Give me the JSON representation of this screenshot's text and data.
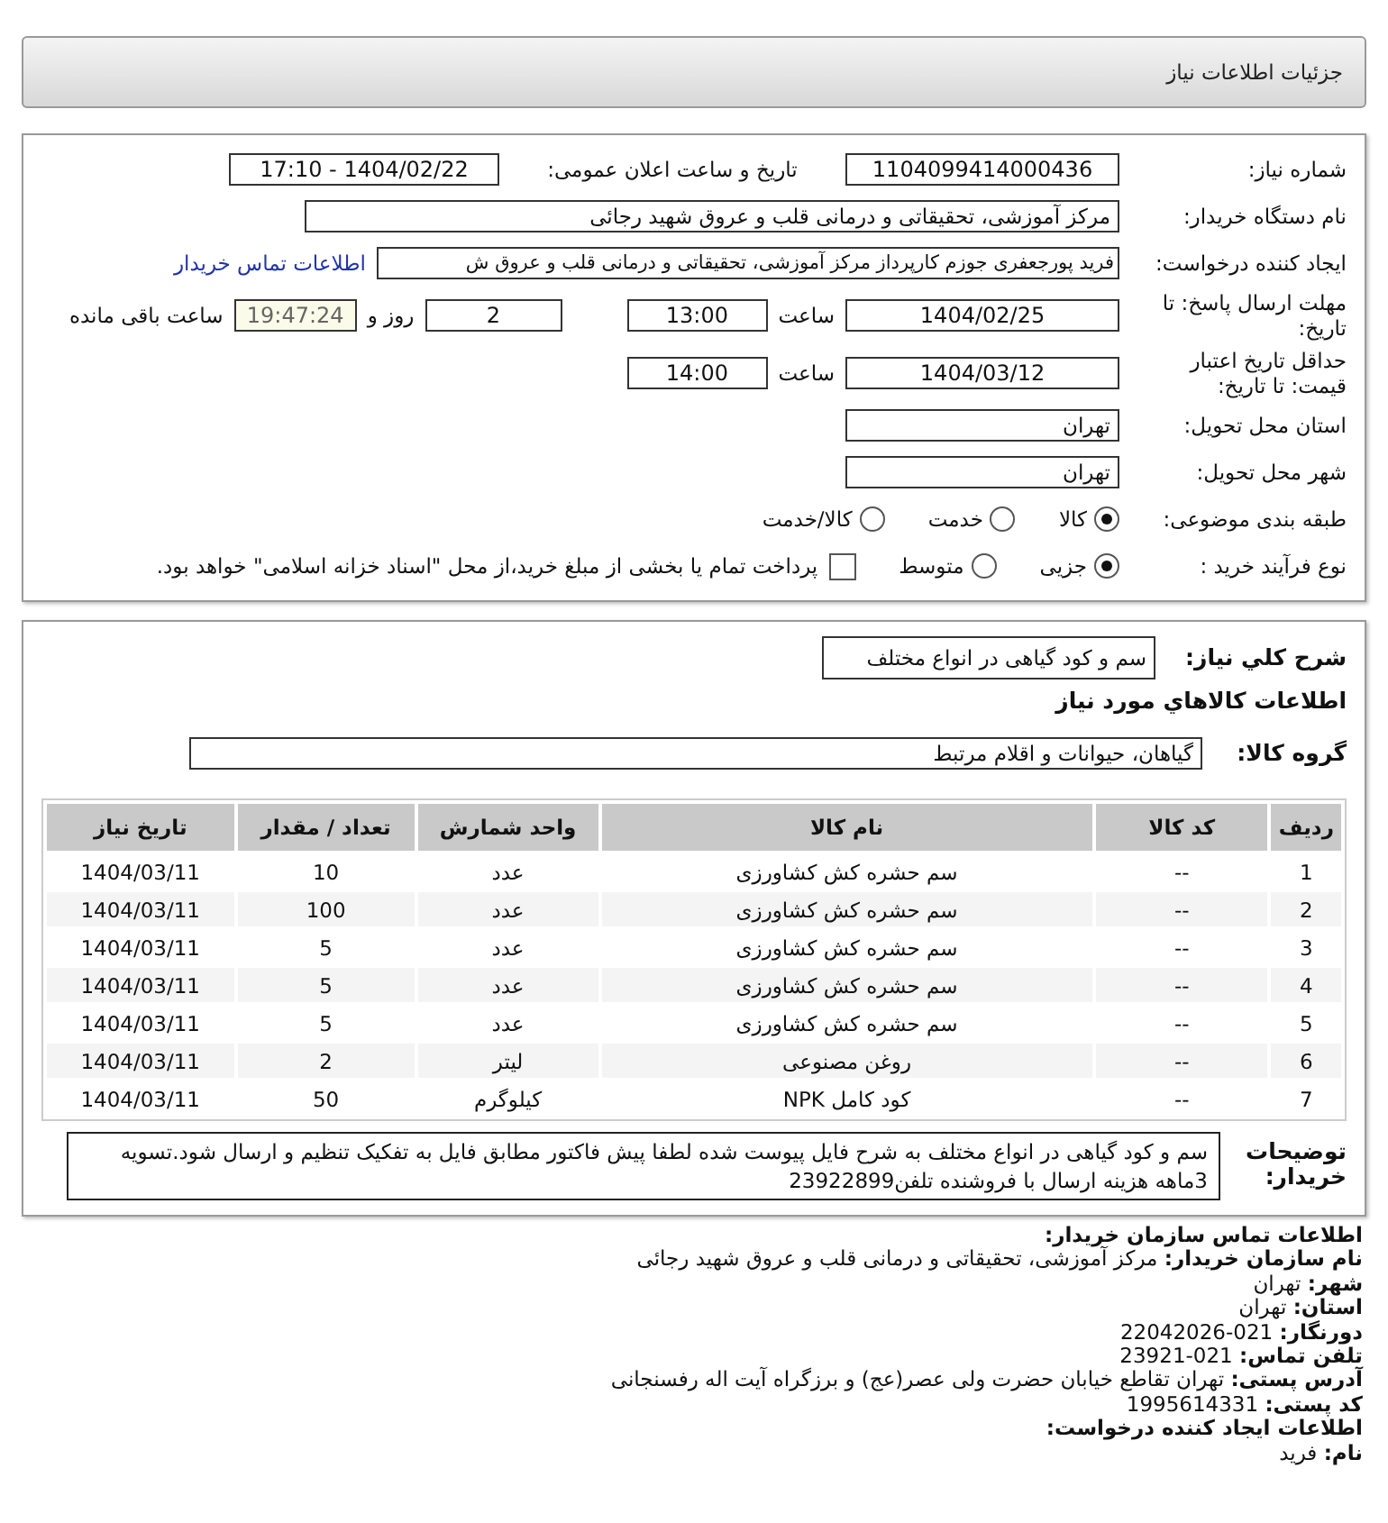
{
  "header": {
    "title": "جزئیات اطلاعات نیاز"
  },
  "need_number": {
    "label": "شماره نیاز:",
    "value": "1104099414000436"
  },
  "announce": {
    "label": "تاریخ و ساعت اعلان عمومی:",
    "value": "1404/02/22 - 17:10"
  },
  "buyer_org": {
    "label": "نام دستگاه خریدار:",
    "value": "مرکز آموزشی، تحقیقاتی و درمانی قلب و عروق شهید رجائی"
  },
  "creator": {
    "label": "ایجاد کننده درخواست:",
    "value": "فرید پورجعفری جوزم کارپرداز  مرکز آموزشی، تحقیقاتی و درمانی قلب و عروق ش",
    "link": "اطلاعات تماس خریدار"
  },
  "response_deadline": {
    "label": "مهلت ارسال پاسخ: تا تاریخ:",
    "date": "1404/02/25",
    "time_label": "ساعت",
    "time": "13:00",
    "days": "2",
    "days_label": "روز و",
    "remaining": "19:47:24",
    "remaining_label": "ساعت باقی مانده"
  },
  "price_validity": {
    "label": "حداقل تاریخ اعتبار قیمت: تا تاریخ:",
    "date": "1404/03/12",
    "time_label": "ساعت",
    "time": "14:00"
  },
  "province": {
    "label": "استان محل تحویل:",
    "value": "تهران"
  },
  "city": {
    "label": "شهر محل تحویل:",
    "value": "تهران"
  },
  "category": {
    "label": "طبقه بندی موضوعی:",
    "options": [
      {
        "label": "کالا",
        "selected": true
      },
      {
        "label": "خدمت",
        "selected": false
      },
      {
        "label": "کالا/خدمت",
        "selected": false
      }
    ]
  },
  "purchase_type": {
    "label": "نوع فرآیند خرید :",
    "options": [
      {
        "label": "جزیی",
        "selected": true
      },
      {
        "label": "متوسط",
        "selected": false
      }
    ],
    "payment": {
      "checked": false,
      "text": "پرداخت تمام یا بخشی از مبلغ خرید،از محل \"اسناد خزانه اسلامی\" خواهد بود."
    }
  },
  "summary": {
    "label": "شرح کلي نياز:",
    "value": "سم و کود گیاهی در انواع مختلف"
  },
  "goods_title": "اطلاعات کالاهاي مورد نياز",
  "goods_group": {
    "label": "گروه کالا:",
    "value": "گیاهان، حیوانات و اقلام مرتبط"
  },
  "table": {
    "columns": [
      "ردیف",
      "کد کالا",
      "نام کالا",
      "واحد شمارش",
      "تعداد / مقدار",
      "تاریخ نیاز"
    ],
    "rows": [
      [
        "1",
        "--",
        "سم حشره کش کشاورزی",
        "عدد",
        "10",
        "1404/03/11"
      ],
      [
        "2",
        "--",
        "سم حشره کش کشاورزی",
        "عدد",
        "100",
        "1404/03/11"
      ],
      [
        "3",
        "--",
        "سم حشره کش کشاورزی",
        "عدد",
        "5",
        "1404/03/11"
      ],
      [
        "4",
        "--",
        "سم حشره کش کشاورزی",
        "عدد",
        "5",
        "1404/03/11"
      ],
      [
        "5",
        "--",
        "سم حشره کش کشاورزی",
        "عدد",
        "5",
        "1404/03/11"
      ],
      [
        "6",
        "--",
        "روغن مصنوعی",
        "لیتر",
        "2",
        "1404/03/11"
      ],
      [
        "7",
        "--",
        "کود کامل NPK",
        "کیلوگرم",
        "50",
        "1404/03/11"
      ]
    ]
  },
  "buyer_notes": {
    "label": "توضیحات خریدار:",
    "value": "سم و کود گیاهی در انواع مختلف به شرح فایل پیوست شده لطفا پیش فاکتور مطابق فایل به تفکیک تنظیم و ارسال شود.تسویه 3ماهه هزینه ارسال با فروشنده تلفن23922899"
  },
  "buyer_contact": {
    "title": "اطلاعات تماس سازمان خریدار:",
    "lines": [
      {
        "label": "نام سازمان خریدار:",
        "value": "مرکز آموزشی، تحقیقاتی و درمانی قلب و عروق شهید رجائی"
      },
      {
        "label": "شهر:",
        "value": "تهران"
      },
      {
        "label": "استان:",
        "value": "تهران"
      },
      {
        "label": "دورنگار:",
        "value": "021-22042026"
      },
      {
        "label": "تلفن تماس:",
        "value": "021-23921"
      },
      {
        "label": "آدرس پستی:",
        "value": "تهران تقاطع خیابان حضرت ولی عصر(عج) و برزگراه آیت اله رفسنجانی"
      },
      {
        "label": "کد پستی:",
        "value": "1995614331"
      }
    ]
  },
  "creator_contact": {
    "title": "اطلاعات ایجاد کننده درخواست:",
    "lines": [
      {
        "label": "نام:",
        "value": "فرید"
      }
    ]
  }
}
